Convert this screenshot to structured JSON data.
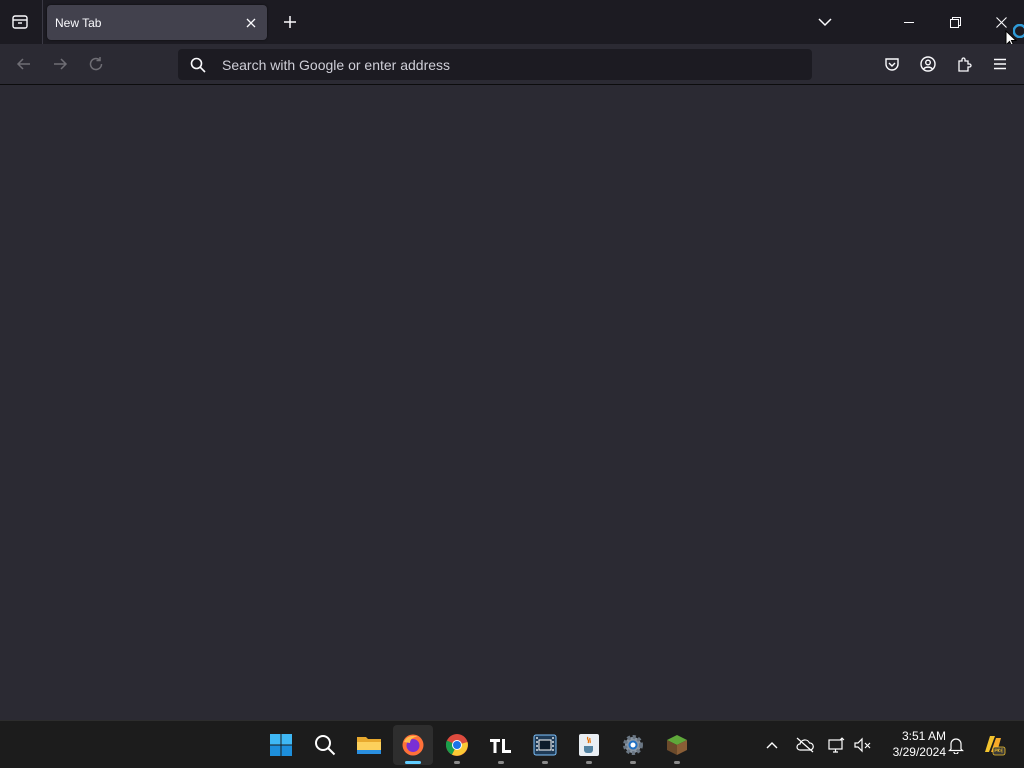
{
  "browser": {
    "tab": {
      "title": "New Tab"
    },
    "urlbar": {
      "placeholder": "Search with Google or enter address",
      "value": ""
    }
  },
  "taskbar": {
    "apps": [
      "start",
      "search",
      "file-explorer",
      "firefox",
      "chrome",
      "tl",
      "video-editor",
      "java",
      "settings",
      "minecraft"
    ],
    "active_app": "firefox"
  },
  "clock": {
    "time": "3:51 AM",
    "date": "3/29/2024"
  },
  "colors": {
    "tabstrip_bg": "#1c1b22",
    "toolbar_bg": "#2b2a33",
    "tab_selected_bg": "#42414d",
    "taskbar_bg": "#1c1c1c",
    "active_indicator": "#60cdff"
  }
}
